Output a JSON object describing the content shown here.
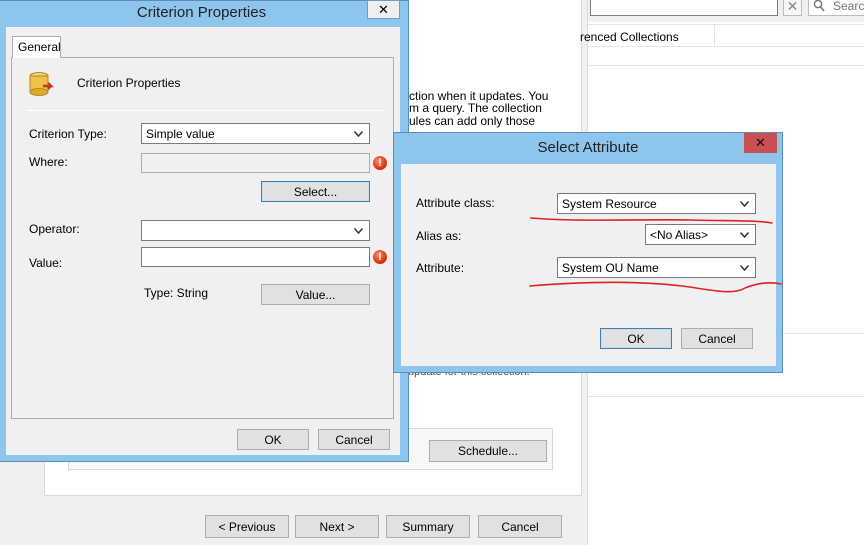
{
  "background_window": {
    "search_placeholder": "Search",
    "column_header": "renced Collections",
    "description_lines": [
      "ction when it updates. You",
      "m a query. The collection",
      "ules can add only those"
    ],
    "hidden_line": "update for this collection.",
    "schedule_label": "Schedule...",
    "nav": {
      "previous": "< Previous",
      "next": "Next >",
      "summary": "Summary",
      "cancel": "Cancel"
    }
  },
  "criterion_dialog": {
    "title": "Criterion Properties",
    "tab_general": "General",
    "header_label": "Criterion Properties",
    "criterion_type_label": "Criterion Type:",
    "criterion_type_value": "Simple value",
    "where_label": "Where:",
    "where_value": "",
    "select_button": "Select...",
    "operator_label": "Operator:",
    "operator_value": "",
    "value_label": "Value:",
    "value_value": "",
    "type_text": "Type: String",
    "value_button": "Value...",
    "ok": "OK",
    "cancel": "Cancel"
  },
  "select_attribute_dialog": {
    "title": "Select Attribute",
    "attribute_class_label": "Attribute class:",
    "attribute_class_value": "System Resource",
    "alias_label": "Alias as:",
    "alias_value": "<No Alias>",
    "attribute_label": "Attribute:",
    "attribute_value": "System OU Name",
    "ok": "OK",
    "cancel": "Cancel"
  },
  "colors": {
    "dialog_frame": "#8ec5ec",
    "close_red": "#c75050",
    "annotation_red": "#e02020"
  }
}
